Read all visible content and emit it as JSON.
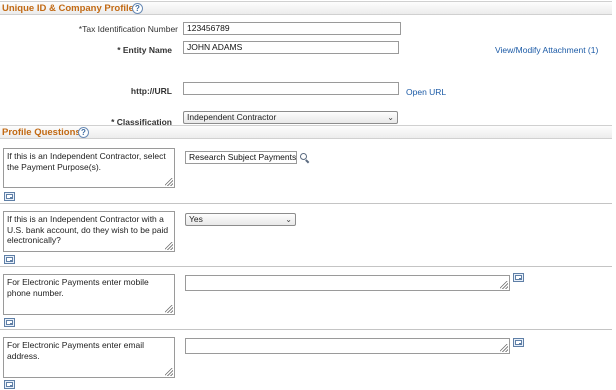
{
  "profile": {
    "title": "Unique ID & Company Profile",
    "tax_id_label": "*Tax Identification Number",
    "tax_id_value": "123456789",
    "entity_name_label": "* Entity Name",
    "entity_name_value": "JOHN ADAMS",
    "attachment_link": "View/Modify Attachment (1)",
    "url_label": "http://URL",
    "url_value": "",
    "open_url_link": "Open URL",
    "classification_label": "* Classification",
    "classification_value": "Independent Contractor"
  },
  "questions": {
    "title": "Profile Questions",
    "items": [
      {
        "text": "If this is an Independent Contractor, select the Payment Purpose(s).",
        "answer": "Research Subject Payments,"
      },
      {
        "text": "If this is an Independent Contractor with a U.S. bank account, do they wish to be paid electronically?",
        "answer": "Yes"
      },
      {
        "text": "For Electronic Payments enter mobile phone number.",
        "answer": ""
      },
      {
        "text": "For Electronic Payments enter email address.",
        "answer": ""
      }
    ]
  },
  "icons": {
    "help": "help-icon",
    "search": "search-icon",
    "expand": "expand-icon",
    "dropdown": "chevron-down-icon"
  },
  "colors": {
    "section_title": "#c26a14",
    "link": "#1b5aa6"
  }
}
